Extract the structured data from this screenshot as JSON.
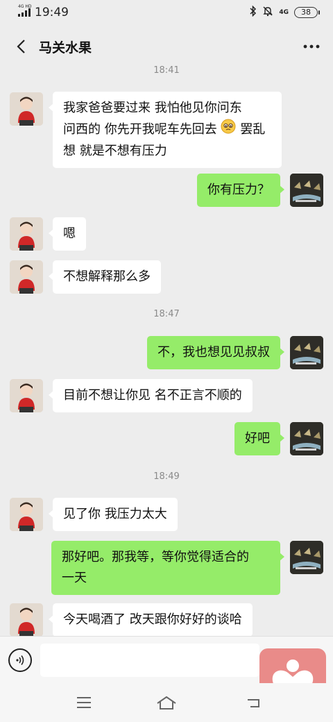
{
  "status_bar": {
    "network": "4G HD",
    "time": "19:49",
    "mobile_data": "4G",
    "battery": "38"
  },
  "header": {
    "title": "马关水果"
  },
  "messages": [
    {
      "type": "time",
      "text": "18:41"
    },
    {
      "type": "msg",
      "side": "left",
      "lines": [
        "我家爸爸要过来 我怕他见你问东",
        "问西的 你先开我呢车先回去",
        "罢乱想 就是不想有压力"
      ],
      "emoji": "pleading-face"
    },
    {
      "type": "msg",
      "side": "right",
      "lines": [
        "你有压力？"
      ]
    },
    {
      "type": "msg",
      "side": "left",
      "lines": [
        "嗯"
      ]
    },
    {
      "type": "msg",
      "side": "left",
      "lines": [
        "不想解释那么多"
      ]
    },
    {
      "type": "time",
      "text": "18:47"
    },
    {
      "type": "msg",
      "side": "right",
      "lines": [
        "不，我也想见见叔叔"
      ]
    },
    {
      "type": "msg",
      "side": "left",
      "lines": [
        "目前不想让你见 名不正言不顺的"
      ]
    },
    {
      "type": "msg",
      "side": "right",
      "lines": [
        "好吧"
      ]
    },
    {
      "type": "time",
      "text": "18:49"
    },
    {
      "type": "msg",
      "side": "left",
      "lines": [
        "见了你 我压力太大"
      ]
    },
    {
      "type": "msg",
      "side": "right",
      "lines": [
        "那好吧。那我等，等你觉得适合的",
        "一天"
      ]
    },
    {
      "type": "msg",
      "side": "left",
      "lines": [
        "今天喝酒了 改天跟你好好的谈哈"
      ]
    }
  ],
  "input": {
    "placeholder": "",
    "value": ""
  },
  "colors": {
    "background": "#ededed",
    "bubble_self": "#95ec69",
    "bubble_other": "#ffffff",
    "floating_app": "#e98b89"
  }
}
